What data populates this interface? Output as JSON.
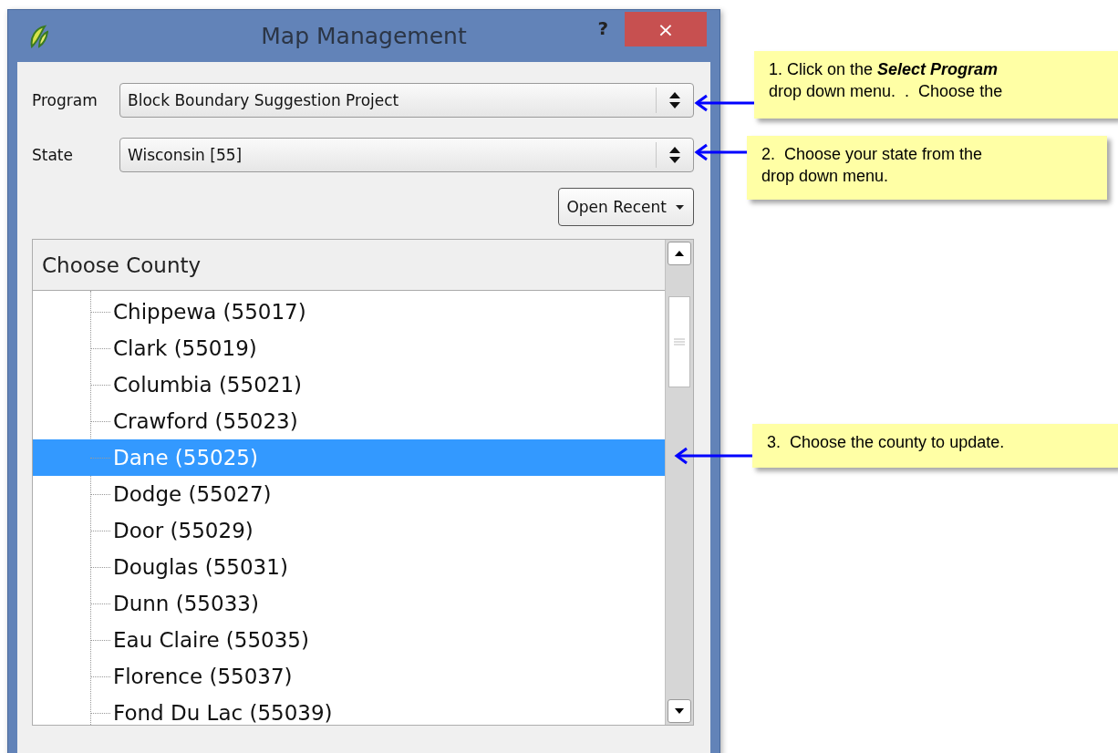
{
  "window": {
    "title": "Map Management",
    "help": "?",
    "close": "×"
  },
  "fields": [
    {
      "label": "Program",
      "value": "Block Boundary Suggestion Project"
    },
    {
      "label": "State",
      "value": "Wisconsin [55]"
    }
  ],
  "open_recent": {
    "label": "Open Recent"
  },
  "tree": {
    "header": "Choose County",
    "items": [
      {
        "label": "Chippewa (55017)",
        "selected": false
      },
      {
        "label": "Clark (55019)",
        "selected": false
      },
      {
        "label": "Columbia (55021)",
        "selected": false
      },
      {
        "label": "Crawford (55023)",
        "selected": false
      },
      {
        "label": "Dane (55025)",
        "selected": true
      },
      {
        "label": "Dodge (55027)",
        "selected": false
      },
      {
        "label": "Door (55029)",
        "selected": false
      },
      {
        "label": "Douglas (55031)",
        "selected": false
      },
      {
        "label": "Dunn (55033)",
        "selected": false
      },
      {
        "label": "Eau Claire (55035)",
        "selected": false
      },
      {
        "label": "Florence (55037)",
        "selected": false
      },
      {
        "label": "Fond Du Lac (55039)",
        "selected": false
      }
    ]
  },
  "callouts": [
    {
      "lines": [
        "1. Click on the **Select Program**",
        "drop down menu.  .  Choose the"
      ]
    },
    {
      "lines": [
        "2.  Choose your state from the",
        "drop down menu."
      ]
    },
    {
      "lines": [
        "3.  Choose the county to update."
      ]
    }
  ]
}
